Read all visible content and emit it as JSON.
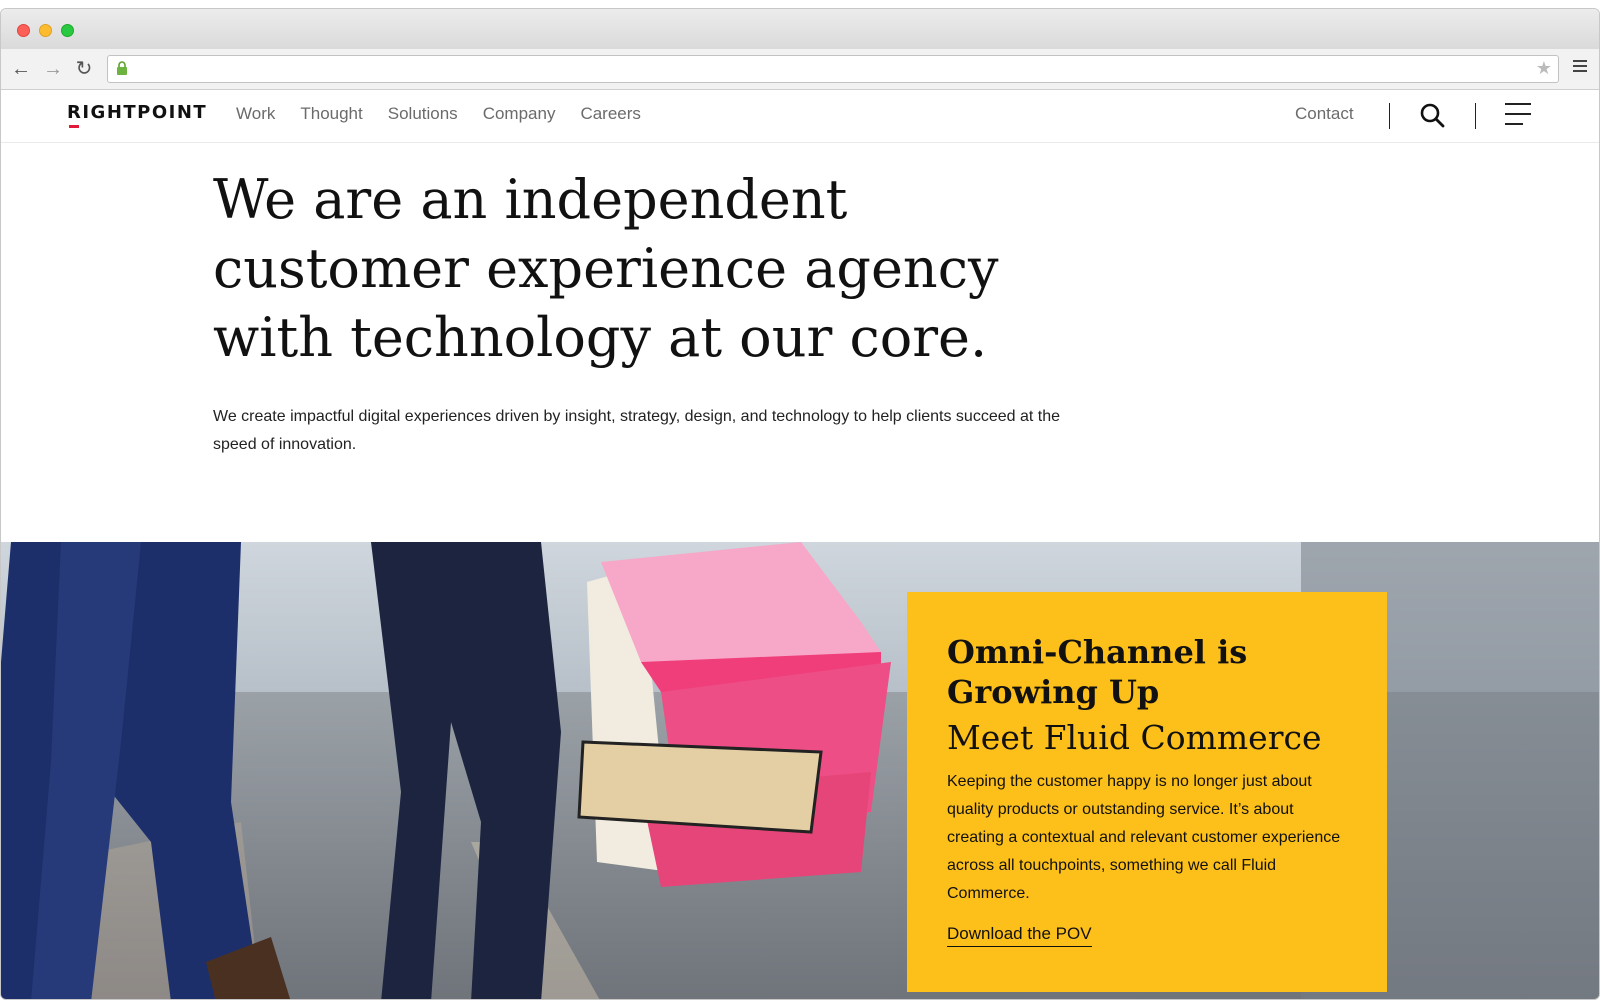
{
  "browser": {
    "back_icon": "←",
    "forward_icon": "→",
    "reload_icon": "↻",
    "star_icon": "★",
    "url": ""
  },
  "site": {
    "logo": "RIGHTPOINT",
    "nav": [
      "Work",
      "Thought",
      "Solutions",
      "Company",
      "Careers"
    ],
    "contact": "Contact"
  },
  "hero": {
    "headline": "We are an independent customer experience agency with technology at our core.",
    "subtext": "We create impactful digital experiences driven by insight, strategy, design, and technology to help clients succeed at the speed of innovation."
  },
  "promo": {
    "title": "Omni-Channel is Growing Up",
    "subtitle": "Meet Fluid Commerce",
    "body": "Keeping the customer happy is no longer just about quality products or outstanding service. It’s about creating a contextual and relevant customer experience across all touchpoints, something we call Fluid Commerce.",
    "link": "Download the POV"
  },
  "colors": {
    "promo_bg": "#fdbf1a",
    "logo_accent": "#e1193b"
  }
}
